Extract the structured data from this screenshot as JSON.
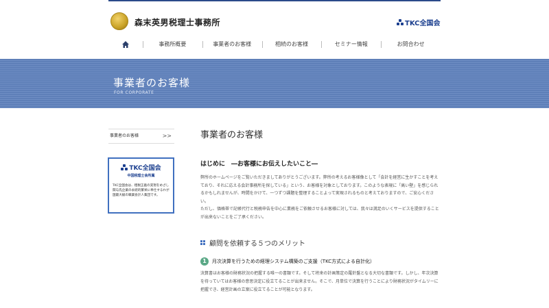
{
  "header": {
    "site_title": "森末英男税理士事務所",
    "tkc_label": "TKC全国会"
  },
  "nav": {
    "items": [
      "事務所概要",
      "事業者のお客様",
      "相続のお客様",
      "セミナー情報",
      "お問合わせ"
    ]
  },
  "banner": {
    "title": "事業者のお客様",
    "subtitle": "FOR CORPORATE"
  },
  "sidebar": {
    "link_label": "事業者のお客様",
    "chevron": ">>",
    "tkc_box": {
      "logo": "TKC全国会",
      "sub": "中国税理士会所属",
      "text": "TKC全国会は、租税正義の実現をめざし関与先企業の永続的繁栄に奉仕するわが国最大級の職業会計人集団です。"
    }
  },
  "main": {
    "page_title": "事業者のお客様",
    "section_title": "はじめに　―お客様にお伝えしたいこと―",
    "intro_p1": "弊所のホームページをご覧いただきましてありがとうございます。弊所の考えるお客様像として「会計を経営に生かすことを考えており、それに応える会計事務所を探している」という、お客様を対象としております。このような表現に「高い壁」を感じられるかもしれませんが、時間をかけて、一つずつ課題を整理することよって実現されるものと考えておりますので、ご安心ください。",
    "intro_p2": "ただし、価格帯で記帳代行と税務申告を中心に業務をご依頼させるお客様に対しては、我々は満足のいくサービスを提供することが出来ないことをご了承ください。",
    "merit_title": "顧問を依頼する５つのメリット",
    "merit1_num": "1",
    "merit1_title": "月次決算を行うための経理システム構築のご支援（TKC方式による自計化）",
    "merit1_text": "決算書はお客様の財務状況の把握する唯一の書類です。そして将来の計画策定の羅針盤となる大切な書類です。しかし、年次決算を待っていてはお客様の意思決定に役立てることが出来ません。そこで、月単位で決算を行うことにより財務状況がタイムリーに把握でき、経営計画の立案に役立てることが可能となります。"
  }
}
